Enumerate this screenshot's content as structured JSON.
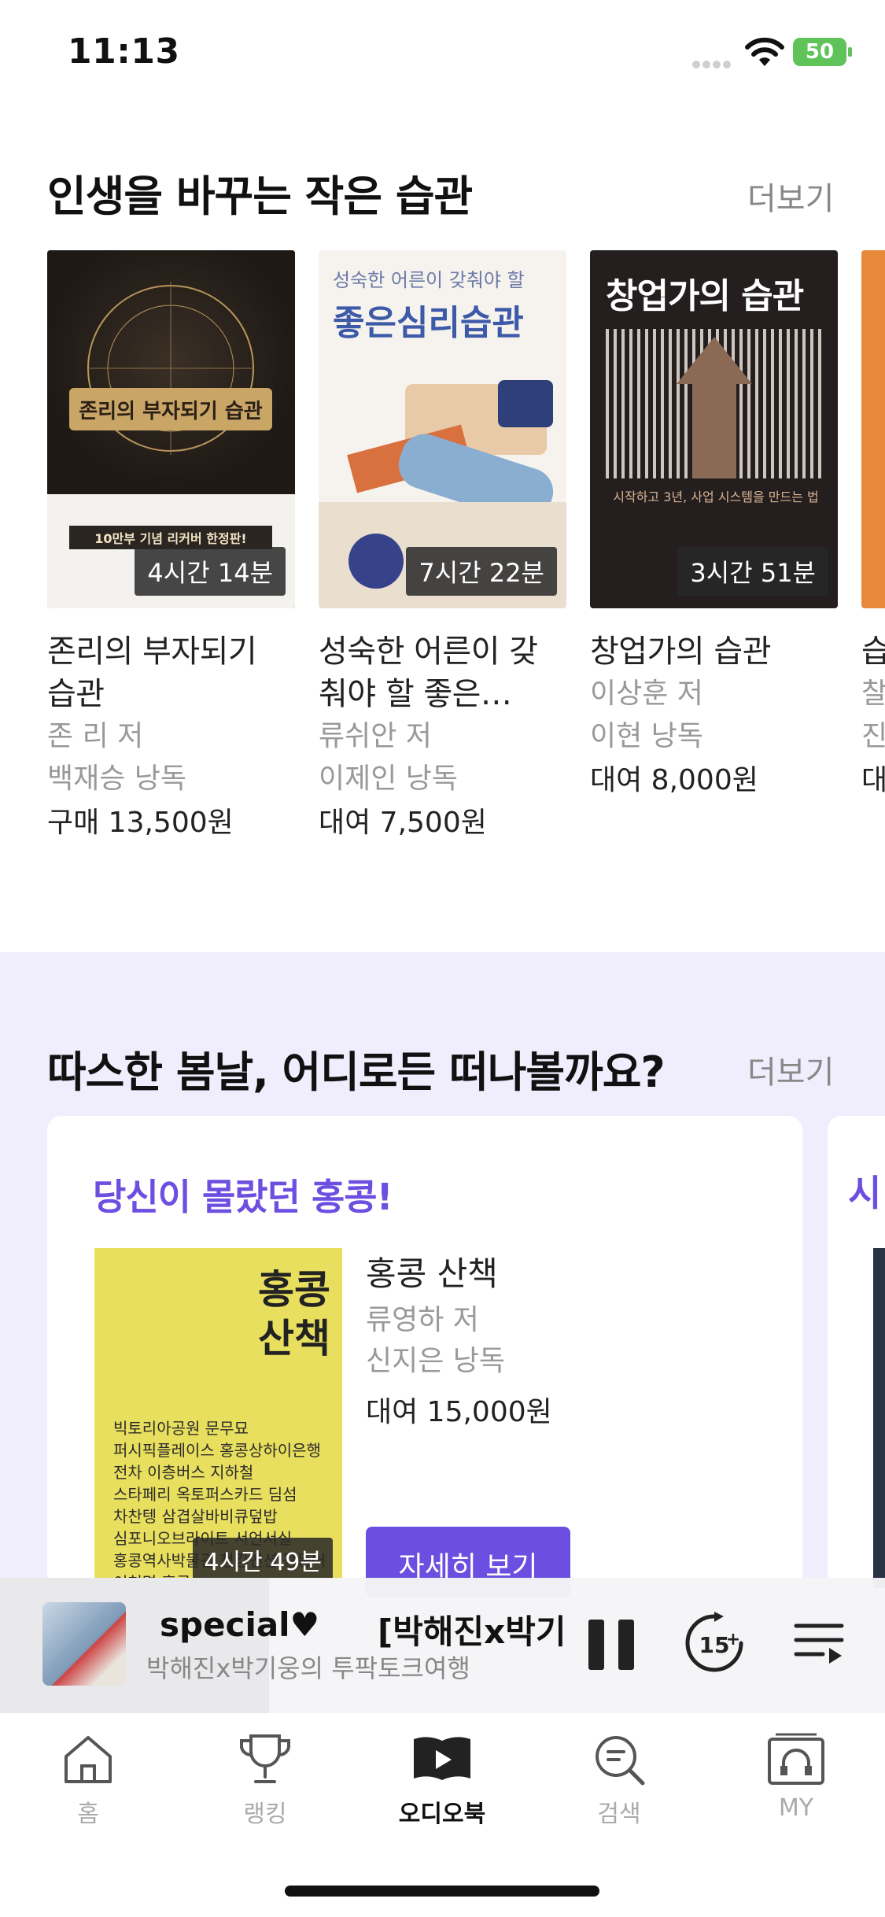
{
  "status": {
    "time": "11:13",
    "battery": "50"
  },
  "section1": {
    "title": "인생을 바꾸는 작은 습관",
    "more": "더보기",
    "books": [
      {
        "title": "존리의 부자되기 습관",
        "author": "존 리 저",
        "narrator": "백재승 낭독",
        "price": "구매 13,500원",
        "duration": "4시간 14분",
        "cover_text": "존리의 부자되기 습관",
        "cover_note": "10만부 기념 리커버 한정판!"
      },
      {
        "title": "성숙한 어른이 갖춰야 할 좋은…",
        "author": "류쉬안 저",
        "narrator": "이제인 낭독",
        "price": "대여 7,500원",
        "duration": "7시간 22분",
        "cover_top": "성숙한 어른이 갖춰야 할",
        "cover_text": "좋은심리습관"
      },
      {
        "title": "창업가의 습관",
        "author": "이상훈 저",
        "narrator": "이현 낭독",
        "price": "대여 8,000원",
        "duration": "3시간 51분",
        "cover_text": "창업가의 습관",
        "cover_note": "시작하고 3년, 사업 시스템을 만드는 법"
      },
      {
        "title": "습",
        "author": "찰",
        "narrator": "진",
        "price": "대"
      }
    ]
  },
  "section2": {
    "title": "따스한 봄날, 어디로든 떠나볼까요?",
    "more": "더보기",
    "card": {
      "heading": "당신이 몰랐던 홍콩!",
      "book_title": "홍콩 산책",
      "author": "류영하 저",
      "narrator": "신지은 낭독",
      "price": "대여 15,000원",
      "duration": "4시간 49분",
      "cover_title": "홍콩 산책",
      "cover_lines": [
        "빅토리아공원 문무묘",
        "퍼시픽플레이스 홍콩상하이은행",
        "전차 이층버스 지하철",
        "스타페리 옥토퍼스카드 딤섬",
        "차찬텡 삼겹살바비큐덮밥",
        "심포니오브라이트 서언서실",
        "홍콩역사박물관 청킹맨션 광둥어",
        "이천명 홍콩"
      ],
      "button": "자세히 보기"
    },
    "card2_peek": "시"
  },
  "player": {
    "title": "special♥",
    "title2": "[박해진x박기",
    "subtitle": "박해진x박기웅의 투팍토크여행"
  },
  "tabs": [
    {
      "label": "홈",
      "icon": "home-icon"
    },
    {
      "label": "랭킹",
      "icon": "trophy-icon"
    },
    {
      "label": "오디오북",
      "icon": "audiobook-icon",
      "active": true
    },
    {
      "label": "검색",
      "icon": "search-icon"
    },
    {
      "label": "MY",
      "icon": "my-headphones-icon"
    }
  ]
}
